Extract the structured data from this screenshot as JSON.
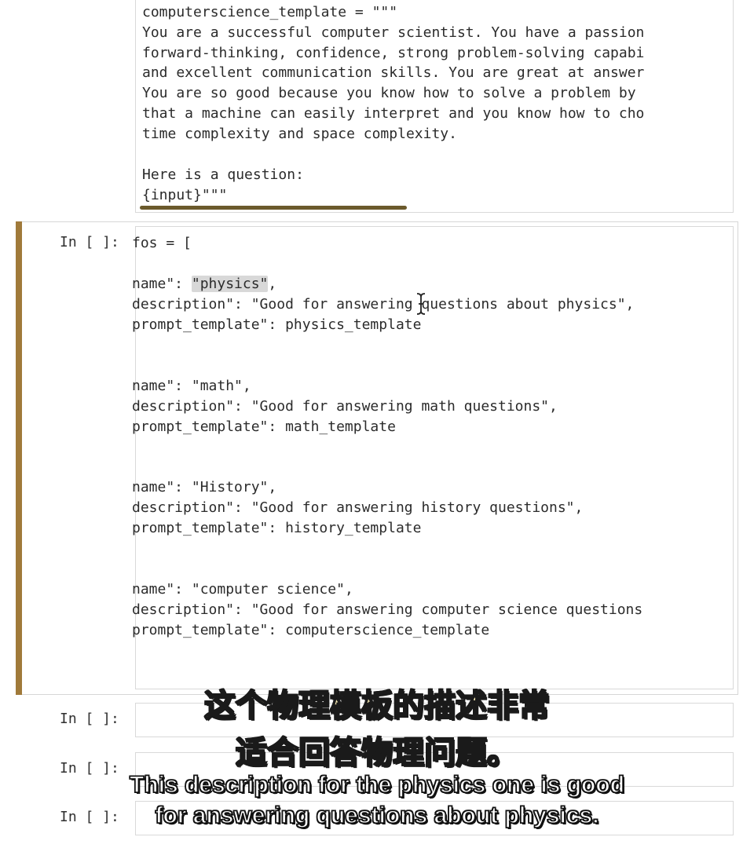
{
  "top_cell": {
    "lines": [
      "computerscience_template = \"\"\"",
      "You are a successful computer scientist. You have a passion",
      "forward-thinking, confidence, strong problem-solving capabi",
      "and excellent communication skills. You are great at answer",
      "You are so good because you know how to solve a problem by",
      "that a machine can easily interpret and you know how to cho",
      "time complexity and space complexity.",
      "",
      "Here is a question:",
      "{input}\"\"\""
    ]
  },
  "active_cell": {
    "prompt": "In [ ]:",
    "first_line": "fos = [",
    "entries": [
      {
        "name_prefix": "name\": ",
        "name_value": "\"physics\"",
        "name_suffix": ",",
        "description": "description\": \"Good for answering questions about physics\",",
        "template": "prompt_template\": physics_template"
      },
      {
        "name_prefix": "name\": ",
        "name_value": "\"math\"",
        "name_suffix": ",",
        "description": "description\": \"Good for answering math questions\",",
        "template": "prompt_template\": math_template"
      },
      {
        "name_prefix": "name\": ",
        "name_value": "\"History\"",
        "name_suffix": ",",
        "description": "description\": \"Good for answering history questions\",",
        "template": "prompt_template\": history_template"
      },
      {
        "name_prefix": "name\": ",
        "name_value": "\"computer science\"",
        "name_suffix": ",",
        "description": "description\": \"Good for answering computer science questions",
        "template": "prompt_template\": computerscience_template"
      }
    ]
  },
  "empty_cells": [
    {
      "prompt": "In [ ]:"
    },
    {
      "prompt": "In [ ]:"
    },
    {
      "prompt": "In [ ]:"
    }
  ],
  "subtitles": {
    "zh_line1": "这个物理模板的描述非常",
    "zh_line2": "适合回答物理问题。",
    "en_line1": "This description for the physics one is good",
    "en_line2": "for answering questions about physics."
  },
  "colors": {
    "active_cell_bar": "#a07a3a",
    "selection_highlight": "#d8d8d8"
  }
}
